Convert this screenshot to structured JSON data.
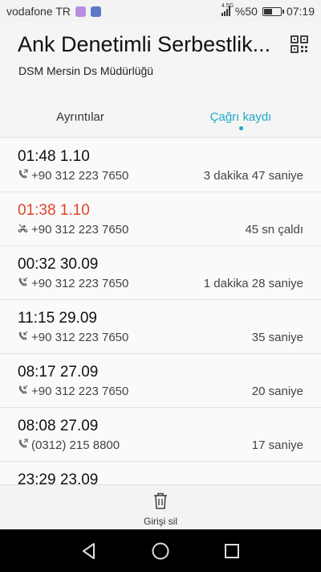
{
  "status_bar": {
    "carrier": "vodafone TR",
    "network": "4.5G",
    "battery": "%50",
    "battery_level": 0.5,
    "time": "07:19"
  },
  "header": {
    "contact_name": "Ank Denetimli Serbestlik...",
    "subtitle": "DSM Mersin Ds Müdürlüğü",
    "qr_icon": "qr-code-icon"
  },
  "tabs": [
    {
      "label": "Ayrıntılar",
      "active": false
    },
    {
      "label": "Çağrı kaydı",
      "active": true
    }
  ],
  "colors": {
    "accent": "#1fa8c7",
    "missed": "#e0442b"
  },
  "call_log": [
    {
      "time": "01:48 1.10",
      "number": "+90 312 223 7650",
      "duration": "3 dakika  47 saniye",
      "type": "outgoing"
    },
    {
      "time": "01:38 1.10",
      "number": "+90 312 223 7650",
      "duration": "45 sn çaldı",
      "type": "missed"
    },
    {
      "time": "00:32 30.09",
      "number": "+90 312 223 7650",
      "duration": "1 dakika  28 saniye",
      "type": "incoming"
    },
    {
      "time": "11:15 29.09",
      "number": "+90 312 223 7650",
      "duration": "35 saniye",
      "type": "incoming"
    },
    {
      "time": "08:17 27.09",
      "number": "+90 312 223 7650",
      "duration": "20 saniye",
      "type": "incoming"
    },
    {
      "time": "08:08 27.09",
      "number": "(0312) 215 8800",
      "duration": "17 saniye",
      "type": "outgoing"
    },
    {
      "time": "23:29 23.09",
      "number": "",
      "duration": "",
      "type": "incoming"
    }
  ],
  "bottom_bar": {
    "delete_label": "Girişi sil",
    "delete_icon": "trash-icon"
  },
  "nav_bar": {
    "back_icon": "back-triangle-icon",
    "home_icon": "home-circle-icon",
    "recents_icon": "recents-square-icon"
  }
}
